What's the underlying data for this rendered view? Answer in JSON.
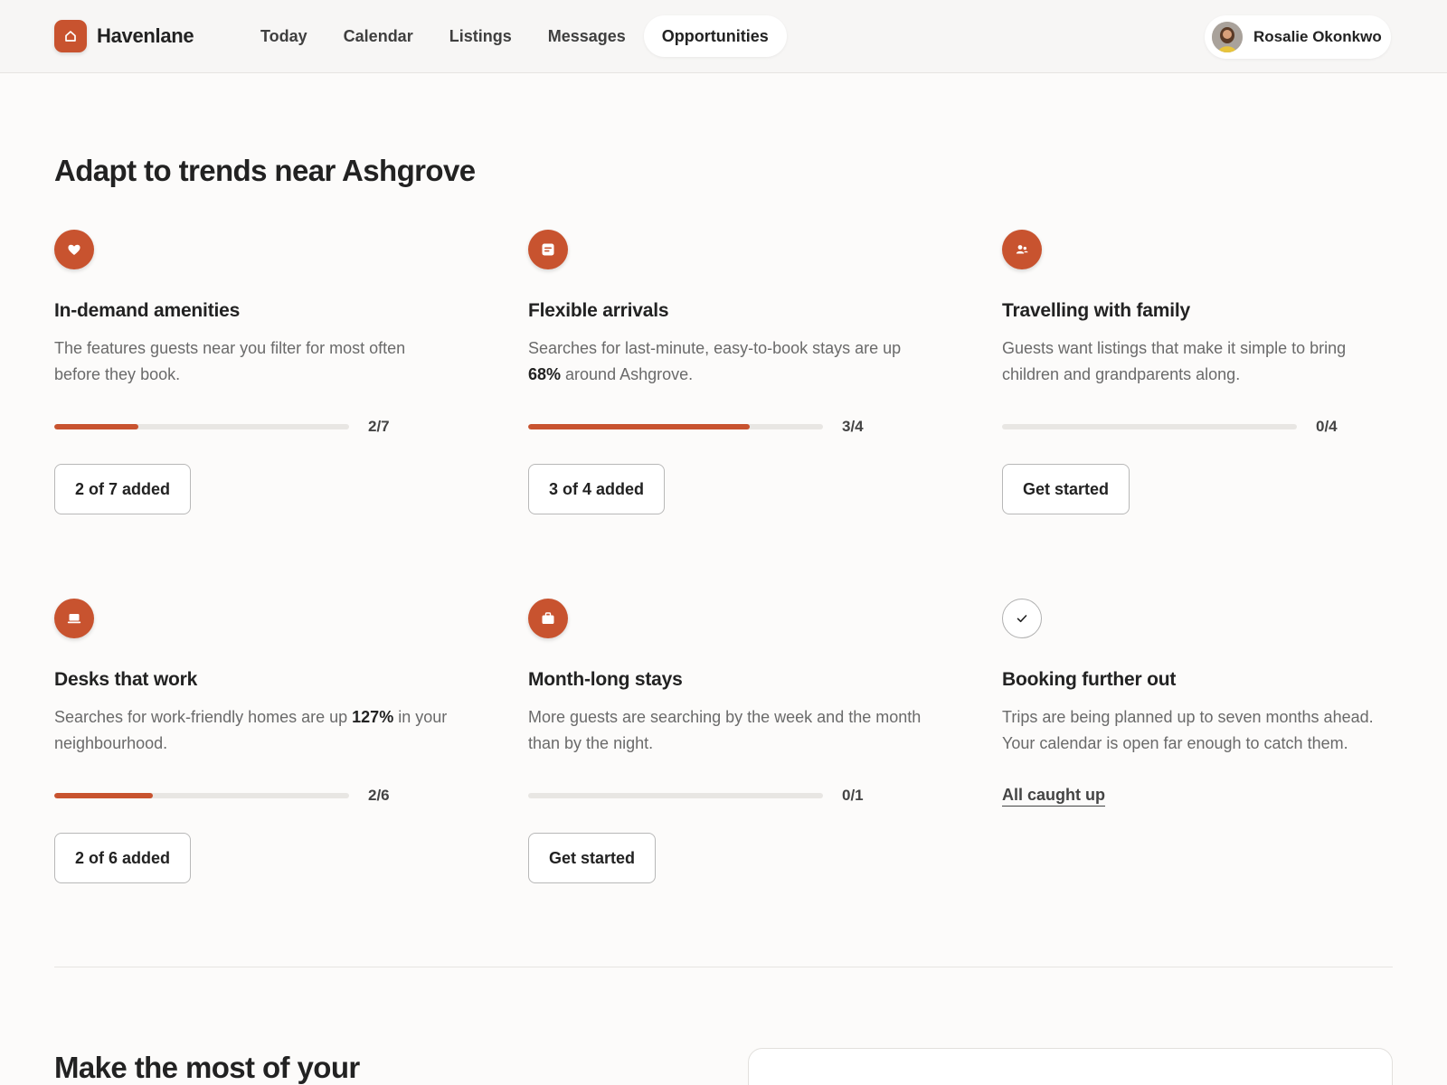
{
  "header": {
    "brand_name": "Havenlane",
    "nav": [
      {
        "label": "Today"
      },
      {
        "label": "Calendar"
      },
      {
        "label": "Listings"
      },
      {
        "label": "Messages"
      },
      {
        "label": "Opportunities",
        "active": true
      }
    ],
    "user_name": "Rosalie Okonkwo"
  },
  "trends": {
    "title": "Adapt to trends near Ashgrove",
    "cards": [
      {
        "icon": "heart-icon",
        "title": "In-demand amenities",
        "description": "The features guests near you filter for most often before they book.",
        "progress_label": "2/7",
        "progress_fraction": 0.2857,
        "button_label": "2 of 7 added"
      },
      {
        "icon": "note-icon",
        "title": "Flexible arrivals",
        "description_pre": "Searches for last-minute, easy-to-book stays are up ",
        "description_bold": "68%",
        "description_post": " around Ashgrove.",
        "progress_label": "3/4",
        "progress_fraction": 0.75,
        "button_label": "3 of 4 added"
      },
      {
        "icon": "family-icon",
        "title": "Travelling with family",
        "description": "Guests want listings that make it simple to bring children and grandparents along.",
        "progress_label": "0/4",
        "progress_fraction": 0,
        "button_label": "Get started"
      },
      {
        "icon": "laptop-icon",
        "title": "Desks that work",
        "description_pre": "Searches for work-friendly homes are up ",
        "description_bold": "127%",
        "description_post": " in your neighbourhood.",
        "progress_label": "2/6",
        "progress_fraction": 0.3333,
        "button_label": "2 of 6 added"
      },
      {
        "icon": "suitcase-icon",
        "title": "Month-long stays",
        "description": "More guests are searching by the week and the month than by the night.",
        "progress_label": "0/1",
        "progress_fraction": 0,
        "button_label": "Get started"
      },
      {
        "icon": "check-icon",
        "title": "Booking further out",
        "description": "Trips are being planned up to seven months ahead. Your calendar is open far enough to catch them.",
        "link_label": "All caught up"
      }
    ]
  },
  "bottom": {
    "title": "Make the most of your"
  },
  "colors": {
    "accent": "#c8532f",
    "background": "#fcfbfa",
    "track": "#e8e6e3"
  }
}
